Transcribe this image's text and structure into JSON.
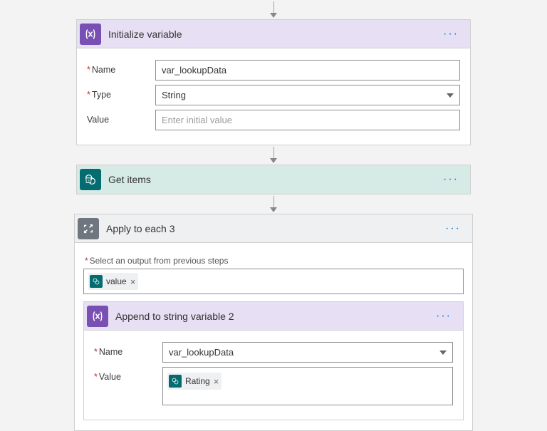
{
  "steps": {
    "init": {
      "title": "Initialize variable",
      "name_label": "Name",
      "name_value": "var_lookupData",
      "type_label": "Type",
      "type_value": "String",
      "value_label": "Value",
      "value_placeholder": "Enter initial value"
    },
    "getitems": {
      "title": "Get items"
    },
    "loop": {
      "title": "Apply to each 3",
      "hint": "Select an output from previous steps",
      "token": "value"
    },
    "append": {
      "title": "Append to string variable 2",
      "name_label": "Name",
      "name_value": "var_lookupData",
      "value_label": "Value",
      "value_token": "Rating"
    }
  }
}
